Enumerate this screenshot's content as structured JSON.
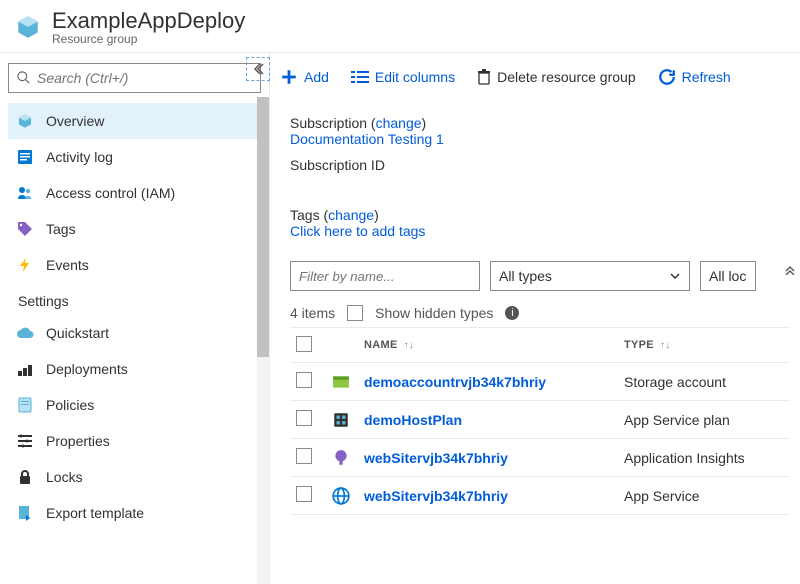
{
  "header": {
    "title": "ExampleAppDeploy",
    "subtitle": "Resource group"
  },
  "search": {
    "placeholder": "Search (Ctrl+/)"
  },
  "nav": {
    "items": [
      {
        "label": "Overview"
      },
      {
        "label": "Activity log"
      },
      {
        "label": "Access control (IAM)"
      },
      {
        "label": "Tags"
      },
      {
        "label": "Events"
      }
    ],
    "settings_heading": "Settings",
    "settings": [
      {
        "label": "Quickstart"
      },
      {
        "label": "Deployments"
      },
      {
        "label": "Policies"
      },
      {
        "label": "Properties"
      },
      {
        "label": "Locks"
      },
      {
        "label": "Export template"
      }
    ]
  },
  "toolbar": {
    "add": "Add",
    "edit_columns": "Edit columns",
    "delete": "Delete resource group",
    "refresh": "Refresh"
  },
  "details": {
    "subscription_label": "Subscription",
    "change": "change",
    "subscription_name": "Documentation Testing 1",
    "subscription_id_label": "Subscription ID",
    "tags_label": "Tags",
    "tags_add": "Click here to add tags"
  },
  "filters": {
    "by_name_placeholder": "Filter by name...",
    "all_types": "All types",
    "all_locations": "All loc"
  },
  "list": {
    "count": "4 items",
    "show_hidden": "Show hidden types",
    "col_name": "NAME",
    "col_type": "TYPE",
    "rows": [
      {
        "name": "demoaccountrvjb34k7bhriy",
        "type": "Storage account"
      },
      {
        "name": "demoHostPlan",
        "type": "App Service plan"
      },
      {
        "name": "webSitervjb34k7bhriy",
        "type": "Application Insights"
      },
      {
        "name": "webSitervjb34k7bhriy",
        "type": "App Service"
      }
    ]
  }
}
